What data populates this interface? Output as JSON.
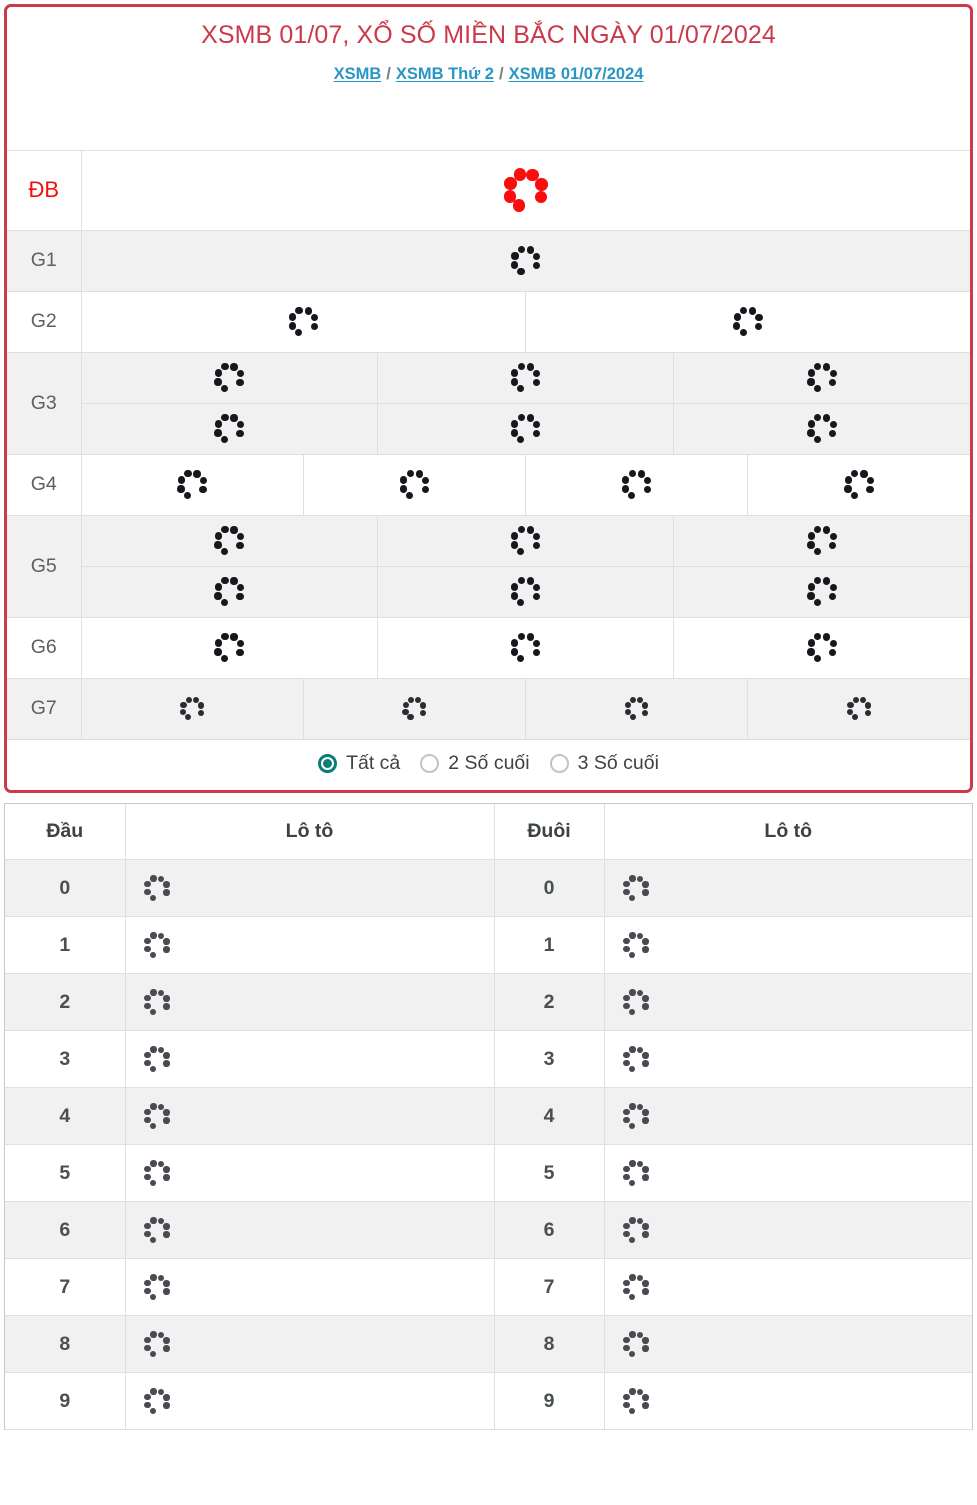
{
  "result_panel": {
    "title": "XSMB 01/07, XỔ SỐ MIỀN BẮC NGÀY 01/07/2024",
    "breadcrumb": {
      "items": [
        {
          "label": "XSMB"
        },
        {
          "label": "XSMB Thứ 2"
        },
        {
          "label": "XSMB 01/07/2024"
        }
      ],
      "separator": "/"
    },
    "loading_spinner_icon": "loading-spinner-icon",
    "prize_rows": [
      {
        "label": "ĐB",
        "cells": 1,
        "rows": 1,
        "shade": "plain",
        "spinner": "sp-red",
        "height_class": "h-db"
      },
      {
        "label": "G1",
        "cells": 1,
        "rows": 1,
        "shade": "alt",
        "spinner": "sp-dark",
        "height_class": "h-g1"
      },
      {
        "label": "G2",
        "cells": 2,
        "rows": 1,
        "shade": "plain",
        "spinner": "sp-dark",
        "height_class": "h-g2"
      },
      {
        "label": "G3",
        "cells": 3,
        "rows": 2,
        "shade": "alt",
        "spinner": "sp-dark",
        "height_class": "h-sub"
      },
      {
        "label": "G4",
        "cells": 4,
        "rows": 1,
        "shade": "plain",
        "spinner": "sp-dark",
        "height_class": "h-g4"
      },
      {
        "label": "G5",
        "cells": 3,
        "rows": 2,
        "shade": "alt",
        "spinner": "sp-dark",
        "height_class": "h-sub"
      },
      {
        "label": "G6",
        "cells": 3,
        "rows": 1,
        "shade": "plain",
        "spinner": "sp-dark",
        "height_class": "h-g6"
      },
      {
        "label": "G7",
        "cells": 4,
        "rows": 1,
        "shade": "alt",
        "spinner": "sp-dark-s",
        "height_class": "h-g7"
      }
    ],
    "filter_options": [
      {
        "label": "Tất cả",
        "selected": true
      },
      {
        "label": "2 Số cuối",
        "selected": false
      },
      {
        "label": "3 Số cuối",
        "selected": false
      }
    ]
  },
  "loto_table": {
    "headers": [
      "Đầu",
      "Lô tô",
      "Đuôi",
      "Lô tô"
    ],
    "rows": [
      {
        "dau": "0",
        "duoi": "0"
      },
      {
        "dau": "1",
        "duoi": "1"
      },
      {
        "dau": "2",
        "duoi": "2"
      },
      {
        "dau": "3",
        "duoi": "3"
      },
      {
        "dau": "4",
        "duoi": "4"
      },
      {
        "dau": "5",
        "duoi": "5"
      },
      {
        "dau": "6",
        "duoi": "6"
      },
      {
        "dau": "7",
        "duoi": "7"
      },
      {
        "dau": "8",
        "duoi": "8"
      },
      {
        "dau": "9",
        "duoi": "9"
      }
    ],
    "loading_spinner_icon": "loading-spinner-icon"
  },
  "colors": {
    "panel_border": "#cd3a4e",
    "title_red": "#ca3a4b",
    "link_blue": "#2796c6",
    "radio_teal": "#0c7d74",
    "db_red": "#f01010",
    "row_alt": "#f1f1f1",
    "grid_line": "#dfdfdf"
  }
}
